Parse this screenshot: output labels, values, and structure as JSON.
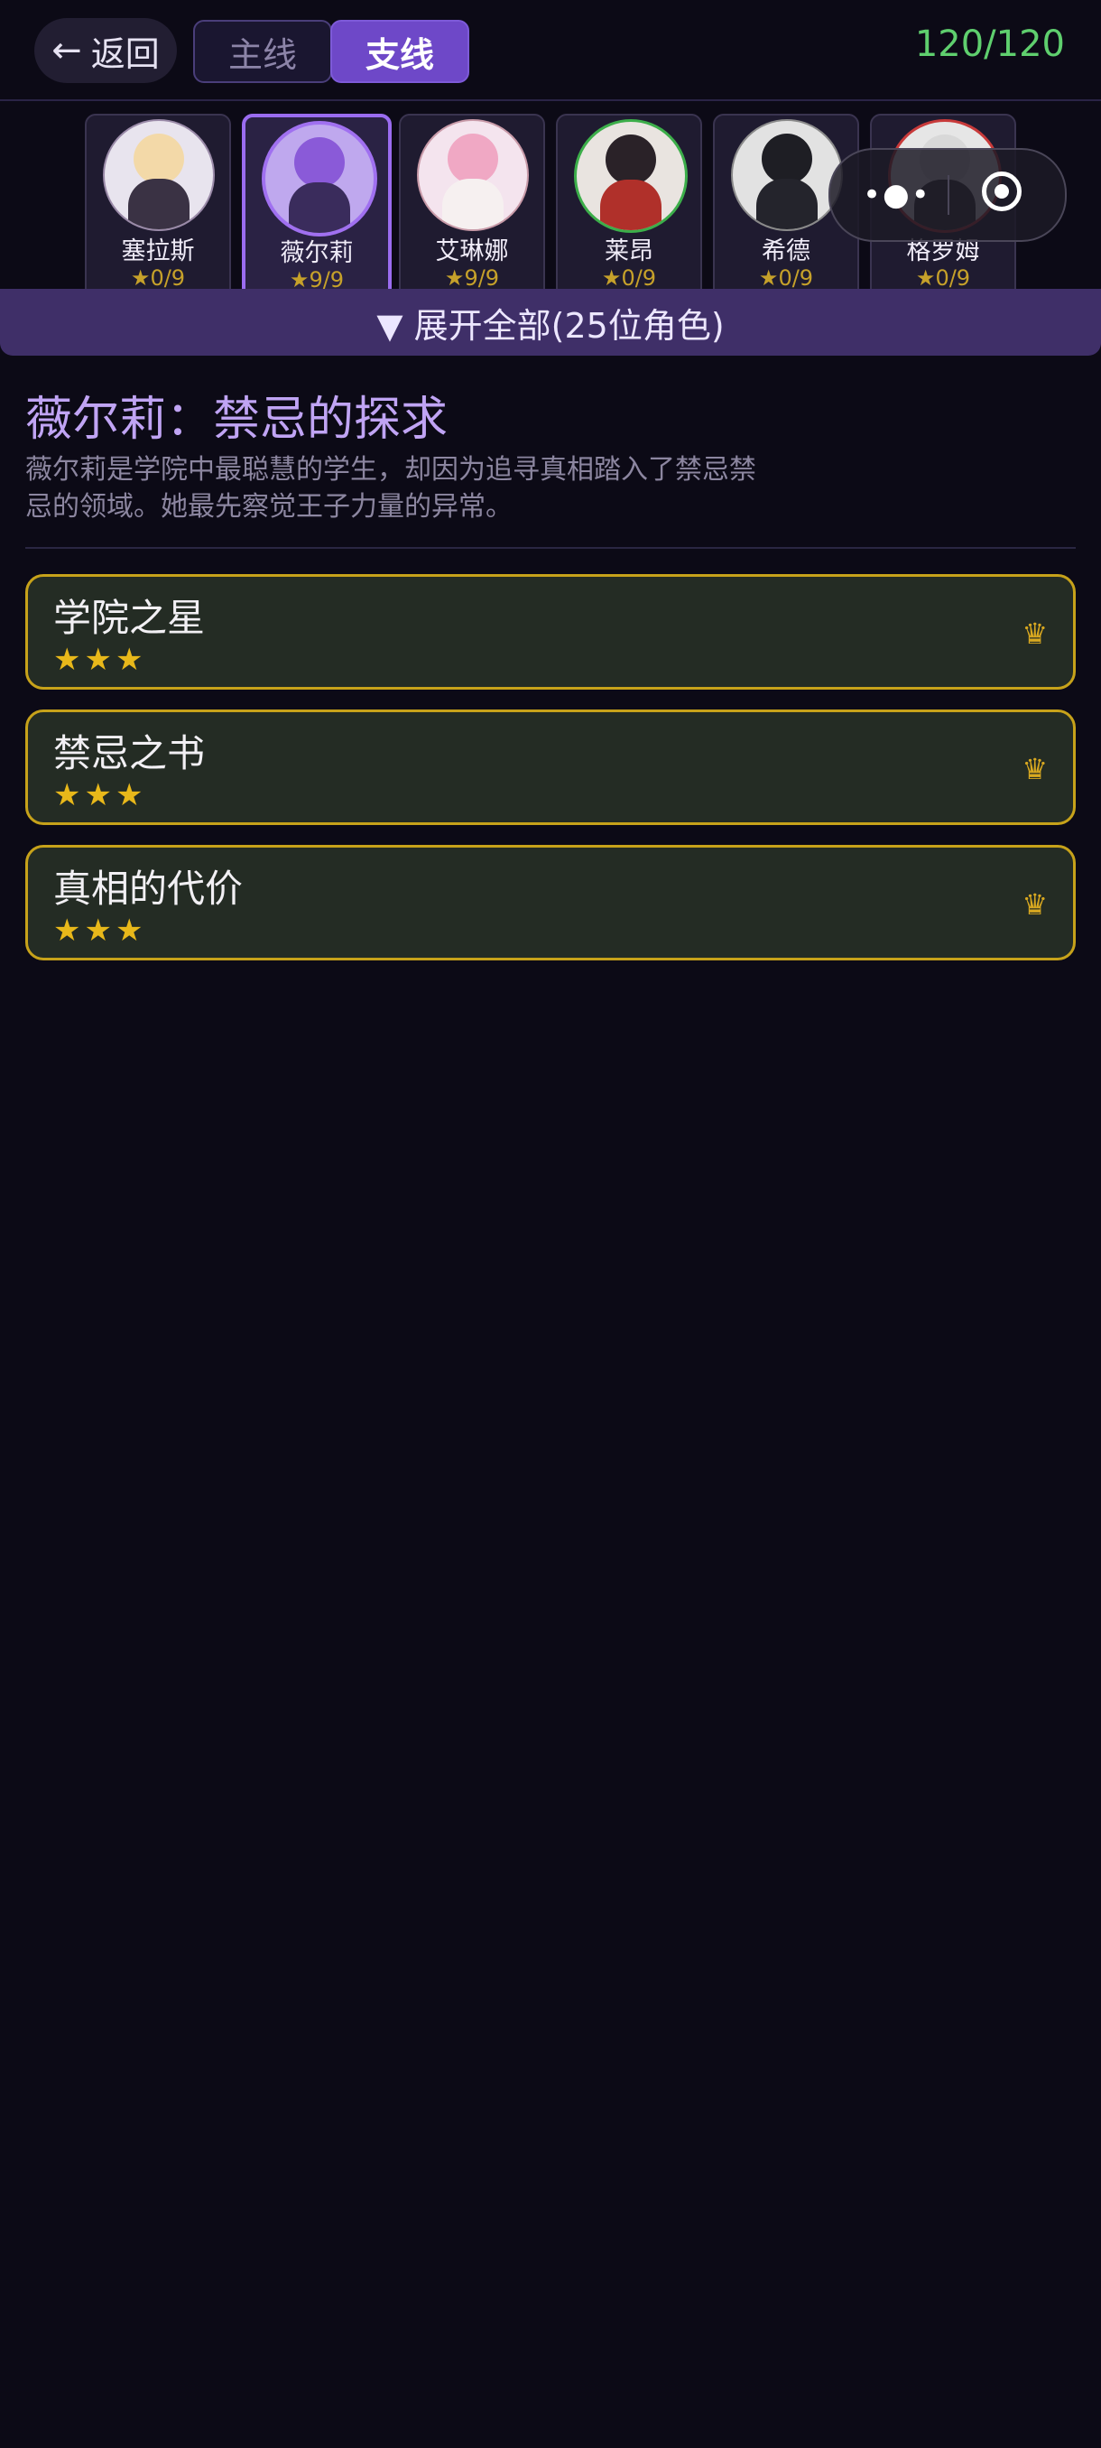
{
  "header": {
    "back_arrow": "←",
    "back_label": "返回",
    "tabs": [
      "主线",
      "支线"
    ],
    "active_tab": "支线",
    "progress": "120/120"
  },
  "characters": [
    {
      "name": "塞拉斯",
      "stars": "★0/9"
    },
    {
      "name": "薇尔莉",
      "stars": "★9/9",
      "selected": true
    },
    {
      "name": "艾琳娜",
      "stars": "★9/9"
    },
    {
      "name": "莱昂",
      "stars": "★0/9"
    },
    {
      "name": "希德",
      "stars": "★0/9"
    },
    {
      "name": "格罗姆",
      "stars": "★0/9"
    }
  ],
  "capsule": {
    "dots": "•●•"
  },
  "expand": {
    "label": "▼ 展开全部(25位角色)"
  },
  "story": {
    "title": "薇尔莉：禁忌的探求",
    "description": "薇尔莉是学院中最聪慧的学生，却因为追寻真相踏入了禁忌禁忌的领域。她最先察觉王子力量的异常。"
  },
  "chapters": [
    {
      "name": "学院之星",
      "stars": "★★★",
      "crown": "♛"
    },
    {
      "name": "禁忌之书",
      "stars": "★★★",
      "crown": "♛"
    },
    {
      "name": "真相的代价",
      "stars": "★★★",
      "crown": "♛"
    }
  ],
  "colors": {
    "background": "#0c0a16",
    "accent_purple": "#6e48c8",
    "progress_green": "#5fcf6e",
    "gold": "#c7a21a"
  }
}
